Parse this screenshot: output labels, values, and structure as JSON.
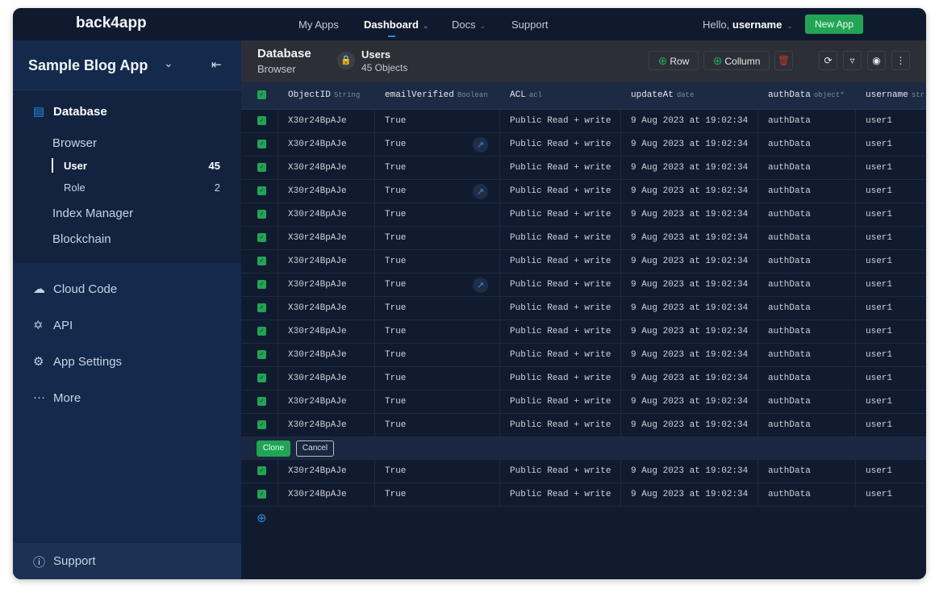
{
  "topnav": {
    "logo": "back4app",
    "items": [
      {
        "label": "My Apps"
      },
      {
        "label": "Dashboard"
      },
      {
        "label": "Docs"
      },
      {
        "label": "Support"
      }
    ],
    "hello": "Hello,",
    "username": "username",
    "new_app": "New App"
  },
  "sidebar": {
    "app_name": "Sample Blog App",
    "database": "Database",
    "browser": "Browser",
    "classes": [
      {
        "label": "User",
        "count": "45"
      },
      {
        "label": "Role",
        "count": "2"
      }
    ],
    "index_manager": "Index Manager",
    "blockchain": "Blockchain",
    "items": [
      {
        "label": "Cloud Code",
        "icon": "cloud-icon"
      },
      {
        "label": "API",
        "icon": "api-icon"
      },
      {
        "label": "App Settings",
        "icon": "gear-icon"
      },
      {
        "label": "More",
        "icon": "more-icon"
      }
    ],
    "support": "Support"
  },
  "header": {
    "title": "Database",
    "subtitle": "Browser",
    "class_name": "Users",
    "object_count": "45 Objects",
    "row_btn": "Row",
    "column_btn": "Collumn"
  },
  "table": {
    "columns": [
      {
        "name": "ObjectID",
        "type": "String"
      },
      {
        "name": "emailVerified",
        "type": "Boolean"
      },
      {
        "name": "ACL",
        "type": "acl"
      },
      {
        "name": "updateAt",
        "type": "date"
      },
      {
        "name": "authData",
        "type": "object*"
      },
      {
        "name": "username",
        "type": "str"
      }
    ],
    "rows": [
      {
        "id": "X30r24BpAJe",
        "verified": "True",
        "acl": "Public Read + write",
        "updated": "9 Aug 2023 at 19:02:34",
        "auth": "authData",
        "user": "user1",
        "link": false
      },
      {
        "id": "X30r24BpAJe",
        "verified": "True",
        "acl": "Public Read + write",
        "updated": "9 Aug 2023 at 19:02:34",
        "auth": "authData",
        "user": "user1",
        "link": true
      },
      {
        "id": "X30r24BpAJe",
        "verified": "True",
        "acl": "Public Read + write",
        "updated": "9 Aug 2023 at 19:02:34",
        "auth": "authData",
        "user": "user1",
        "link": false
      },
      {
        "id": "X30r24BpAJe",
        "verified": "True",
        "acl": "Public Read + write",
        "updated": "9 Aug 2023 at 19:02:34",
        "auth": "authData",
        "user": "user1",
        "link": true
      },
      {
        "id": "X30r24BpAJe",
        "verified": "True",
        "acl": "Public Read + write",
        "updated": "9 Aug 2023 at 19:02:34",
        "auth": "authData",
        "user": "user1",
        "link": false
      },
      {
        "id": "X30r24BpAJe",
        "verified": "True",
        "acl": "Public Read + write",
        "updated": "9 Aug 2023 at 19:02:34",
        "auth": "authData",
        "user": "user1",
        "link": false
      },
      {
        "id": "X30r24BpAJe",
        "verified": "True",
        "acl": "Public Read + write",
        "updated": "9 Aug 2023 at 19:02:34",
        "auth": "authData",
        "user": "user1",
        "link": false
      },
      {
        "id": "X30r24BpAJe",
        "verified": "True",
        "acl": "Public Read + write",
        "updated": "9 Aug 2023 at 19:02:34",
        "auth": "authData",
        "user": "user1",
        "link": true
      },
      {
        "id": "X30r24BpAJe",
        "verified": "True",
        "acl": "Public Read + write",
        "updated": "9 Aug 2023 at 19:02:34",
        "auth": "authData",
        "user": "user1",
        "link": false
      },
      {
        "id": "X30r24BpAJe",
        "verified": "True",
        "acl": "Public Read + write",
        "updated": "9 Aug 2023 at 19:02:34",
        "auth": "authData",
        "user": "user1",
        "link": false
      },
      {
        "id": "X30r24BpAJe",
        "verified": "True",
        "acl": "Public Read + write",
        "updated": "9 Aug 2023 at 19:02:34",
        "auth": "authData",
        "user": "user1",
        "link": false
      },
      {
        "id": "X30r24BpAJe",
        "verified": "True",
        "acl": "Public Read + write",
        "updated": "9 Aug 2023 at 19:02:34",
        "auth": "authData",
        "user": "user1",
        "link": false
      },
      {
        "id": "X30r24BpAJe",
        "verified": "True",
        "acl": "Public Read + write",
        "updated": "9 Aug 2023 at 19:02:34",
        "auth": "authData",
        "user": "user1",
        "link": false
      },
      {
        "id": "X30r24BpAJe",
        "verified": "True",
        "acl": "Public Read + write",
        "updated": "9 Aug 2023 at 19:02:34",
        "auth": "authData",
        "user": "user1",
        "link": false
      }
    ],
    "rows_after": [
      {
        "id": "X30r24BpAJe",
        "verified": "True",
        "acl": "Public Read + write",
        "updated": "9 Aug 2023 at 19:02:34",
        "auth": "authData",
        "user": "user1",
        "link": false
      },
      {
        "id": "X30r24BpAJe",
        "verified": "True",
        "acl": "Public Read + write",
        "updated": "9 Aug 2023 at 19:02:34",
        "auth": "authData",
        "user": "user1",
        "link": false
      }
    ],
    "clone_label": "Clone",
    "cancel_label": "Cancel"
  },
  "colors": {
    "accent": "#22a455",
    "link": "#2a8ad8",
    "danger": "#c0392b"
  }
}
